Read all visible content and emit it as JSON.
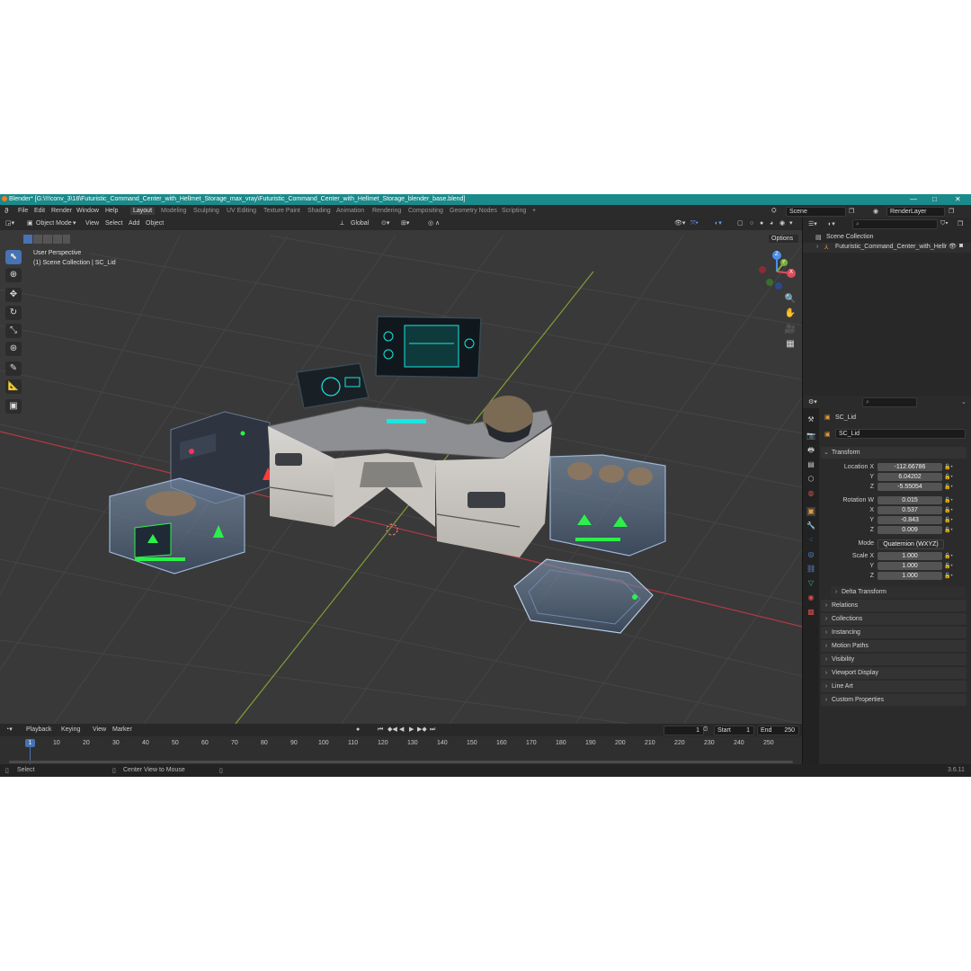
{
  "title_bar": {
    "text": "Blender* [G:\\!!!conv_3\\18\\Futuristic_Command_Center_with_Hellmet_Storage_max_vray\\Futuristic_Command_Center_with_Hellmet_Storage_blender_base.blend]",
    "minimize": "—",
    "maximize": "□",
    "close": "✕"
  },
  "menu": {
    "items": [
      "File",
      "Edit",
      "Render",
      "Window",
      "Help"
    ],
    "workspaces": [
      "Layout",
      "Modeling",
      "Sculpting",
      "UV Editing",
      "Texture Paint",
      "Shading",
      "Animation",
      "Rendering",
      "Compositing",
      "Geometry Nodes",
      "Scripting"
    ],
    "add_tab": "+",
    "scene": "Scene",
    "render_layer": "RenderLayer"
  },
  "viewport": {
    "mode": "Object Mode",
    "menus": [
      "View",
      "Select",
      "Add",
      "Object"
    ],
    "orientation": "Global",
    "options": "Options",
    "overlay_text": "User Perspective",
    "overlay_collection": "(1) Scene Collection | SC_Lid",
    "gizmo_x": "X",
    "gizmo_y": "Y",
    "gizmo_z": "Z"
  },
  "outliner": {
    "root": "Scene Collection",
    "item": "Futuristic_Command_Center_with_Hellr"
  },
  "properties": {
    "object_name": "SC_Lid",
    "data_name": "SC_Lid",
    "transform_label": "Transform",
    "location": {
      "label": "Location X",
      "x": "-112.66786",
      "y": "6.04202",
      "z": "-5.55054"
    },
    "rotation": {
      "label": "Rotation W",
      "w": "0.015",
      "x": "0.537",
      "y": "-0.843",
      "z": "0.009"
    },
    "mode": {
      "label": "Mode",
      "value": "Quaternion (WXYZ)"
    },
    "scale": {
      "label": "Scale X",
      "x": "1.000",
      "y": "1.000",
      "z": "1.000"
    },
    "axis_y": "Y",
    "axis_z": "Z",
    "axis_x": "X",
    "delta_transform": "Delta Transform",
    "panels": [
      "Relations",
      "Collections",
      "Instancing",
      "Motion Paths",
      "Visibility",
      "Viewport Display",
      "Line Art",
      "Custom Properties"
    ]
  },
  "timeline": {
    "menus": [
      "Playback",
      "Keying",
      "View",
      "Marker"
    ],
    "current_frame": "1",
    "start_label": "Start",
    "start": "1",
    "end_label": "End",
    "end": "250",
    "frame_labels": [
      "1",
      "10",
      "20",
      "30",
      "40",
      "50",
      "60",
      "70",
      "80",
      "90",
      "100",
      "110",
      "120",
      "130",
      "140",
      "150",
      "160",
      "170",
      "180",
      "190",
      "200",
      "210",
      "220",
      "230",
      "240",
      "250"
    ]
  },
  "status": {
    "select": "Select",
    "center": "Center View to Mouse",
    "version": "3.6.11"
  },
  "colors": {
    "title_bar": "#1a8a8a",
    "accent_blue": "#4772b3",
    "viewport_bg": "#393939",
    "neon_green": "#2cf04a",
    "neon_cyan": "#19e6e0"
  }
}
